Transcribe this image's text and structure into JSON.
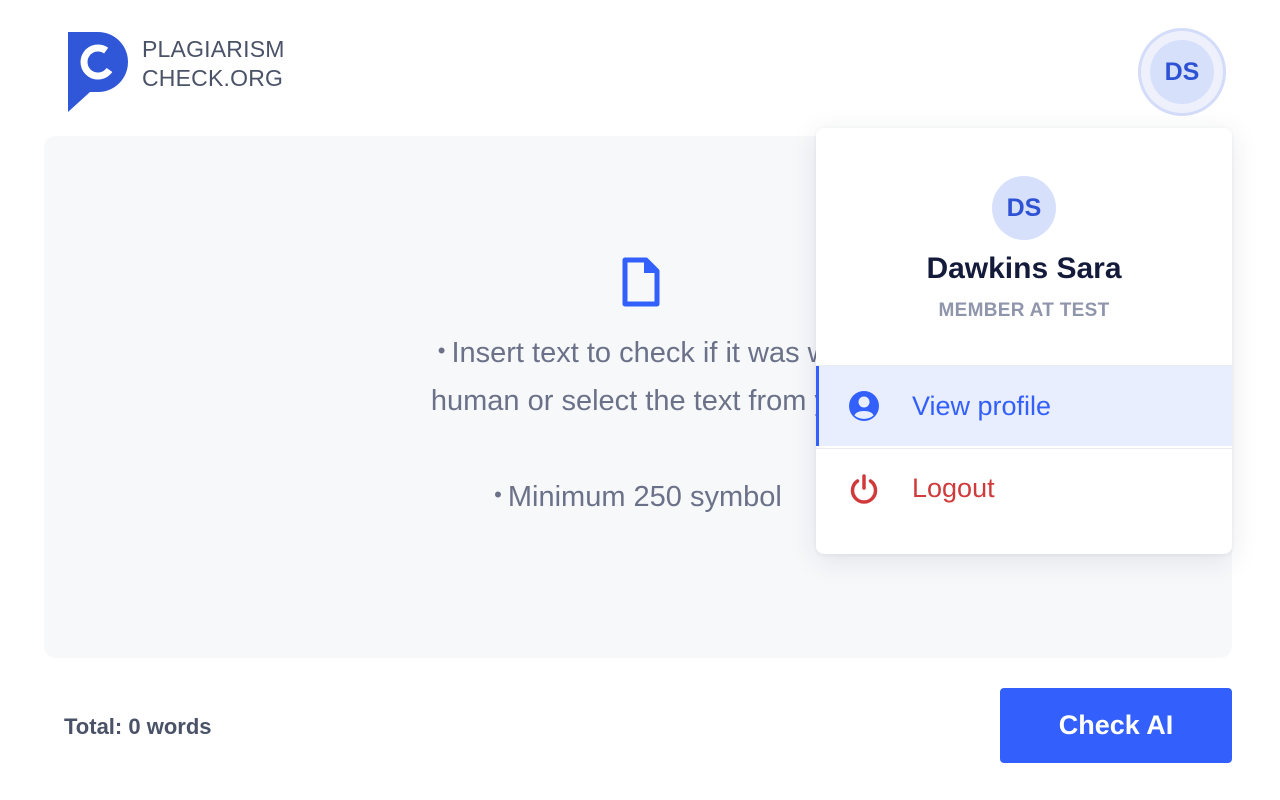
{
  "brand": {
    "line1": "PLAGIARISM",
    "line2": "CHECK.ORG",
    "color": "#2f57d8"
  },
  "header": {
    "avatar_initials": "DS"
  },
  "editor": {
    "hint_line1": "Insert text to check if it was wr",
    "hint_line2": "human or select the text from yo",
    "hint_min": "Minimum 250 symbol",
    "file_icon": "document-icon"
  },
  "footer": {
    "total_label": "Total: 0 words",
    "check_button": "Check AI"
  },
  "user_menu": {
    "initials": "DS",
    "name": "Dawkins Sara",
    "role": "MEMBER AT TEST",
    "items": [
      {
        "label": "View profile",
        "icon": "user-icon",
        "active": true
      },
      {
        "label": "Logout",
        "icon": "power-icon",
        "active": false
      }
    ]
  },
  "colors": {
    "accent": "#3360fc",
    "danger": "#d03a3a",
    "panel_bg": "#f7f8fa",
    "avatar_bg": "#d7e0fb"
  }
}
